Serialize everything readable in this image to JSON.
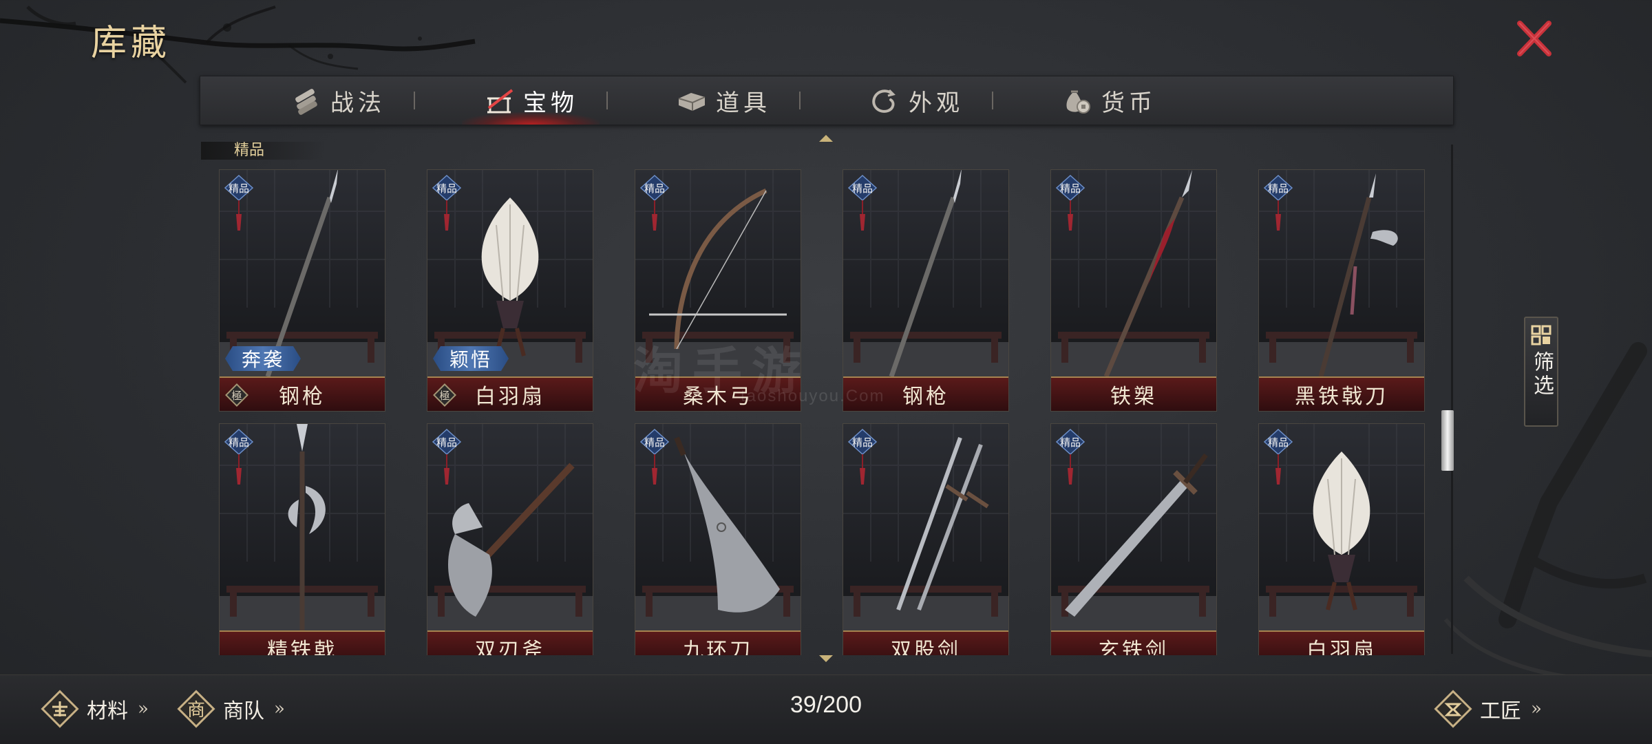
{
  "header": {
    "title": "库藏"
  },
  "tabs": [
    {
      "label": "战法",
      "icon": "scroll-bundle-icon",
      "active": false
    },
    {
      "label": "宝物",
      "icon": "weapon-rack-icon",
      "active": true
    },
    {
      "label": "道具",
      "icon": "chest-icon",
      "active": false
    },
    {
      "label": "外观",
      "icon": "swirl-icon",
      "active": false
    },
    {
      "label": "货币",
      "icon": "money-bag-icon",
      "active": false
    }
  ],
  "section": {
    "label": "精品"
  },
  "items": [
    {
      "name": "钢枪",
      "rank": "精品",
      "skill": "奔袭",
      "grade": "極",
      "art": "spear"
    },
    {
      "name": "白羽扇",
      "rank": "精品",
      "skill": "颖悟",
      "grade": "極",
      "art": "fan"
    },
    {
      "name": "桑木弓",
      "rank": "精品",
      "skill": "",
      "grade": "",
      "art": "bow"
    },
    {
      "name": "钢枪",
      "rank": "精品",
      "skill": "",
      "grade": "",
      "art": "spear"
    },
    {
      "name": "铁槊",
      "rank": "精品",
      "skill": "",
      "grade": "",
      "art": "lance"
    },
    {
      "name": "黑铁戟刀",
      "rank": "精品",
      "skill": "",
      "grade": "",
      "art": "halberd"
    },
    {
      "name": "精铁戟",
      "rank": "精品",
      "skill": "",
      "grade": "",
      "art": "ji"
    },
    {
      "name": "双刃斧",
      "rank": "精品",
      "skill": "",
      "grade": "",
      "art": "axe"
    },
    {
      "name": "九环刀",
      "rank": "精品",
      "skill": "",
      "grade": "",
      "art": "broadsword"
    },
    {
      "name": "双股剑",
      "rank": "精品",
      "skill": "",
      "grade": "",
      "art": "twinswords"
    },
    {
      "name": "玄铁剑",
      "rank": "精品",
      "skill": "",
      "grade": "",
      "art": "sword"
    },
    {
      "name": "白羽扇",
      "rank": "精品",
      "skill": "",
      "grade": "",
      "art": "fan"
    }
  ],
  "filter": {
    "label": "筛选",
    "icon": "grid-icon"
  },
  "footer": {
    "materials_label": "材料",
    "caravan_label": "商队",
    "caravan_badge": "商",
    "craftsman_label": "工匠",
    "chevron": "»",
    "counter": "39/200"
  },
  "watermark": {
    "main": "淘手游",
    "sub": "taoshouyou.Com"
  },
  "colors": {
    "accent_gold": "#e9d3a1",
    "close_red": "#c8323a",
    "namebar_red": "#5a1a1a",
    "rank_blue": "#2a4d84"
  }
}
